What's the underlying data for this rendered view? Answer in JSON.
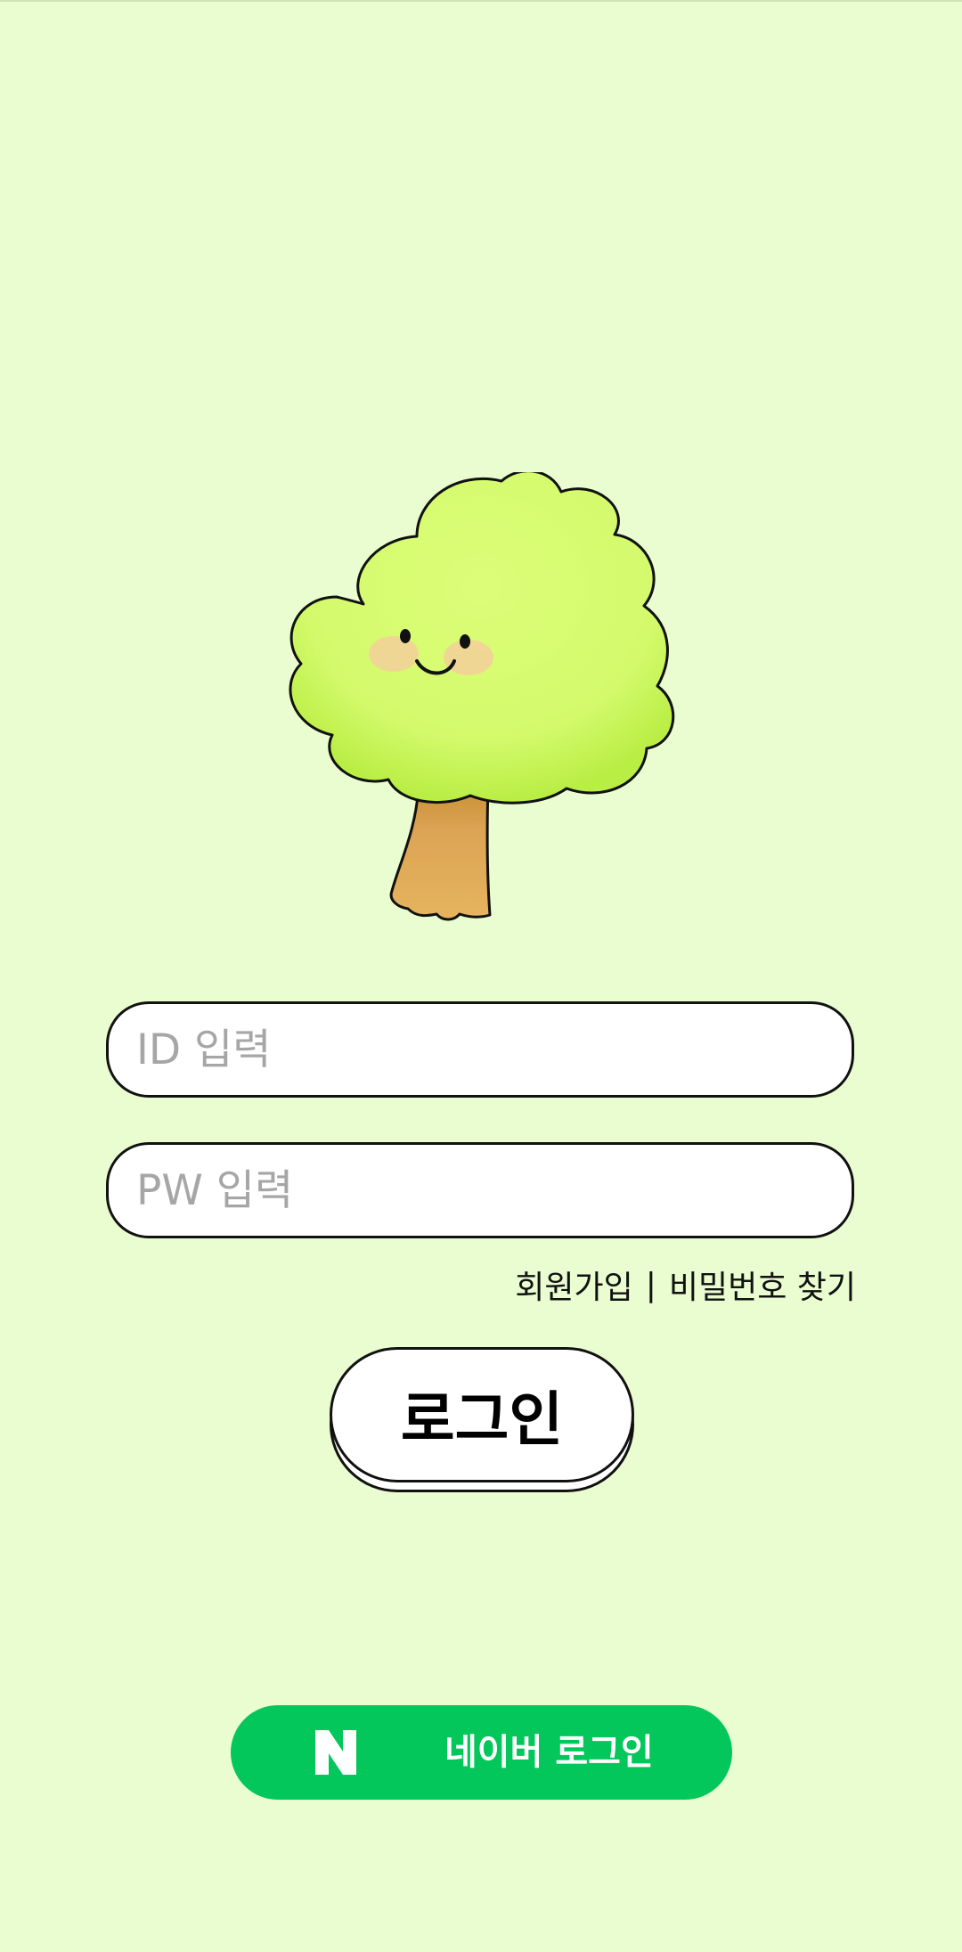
{
  "login_form": {
    "id_placeholder": "ID 입력",
    "pw_placeholder": "PW 입력",
    "signup_link": "회원가입",
    "link_separator": "|",
    "find_password_link": "비밀번호 찾기",
    "login_button": "로그인"
  },
  "social_login": {
    "naver_logo_letter": "N",
    "naver_label": "네이버 로그인"
  },
  "mascot": {
    "icon": "smiling-tree-icon"
  },
  "colors": {
    "background": "#e9fdd0",
    "naver_green": "#03c75a",
    "foliage": "#d6fb72",
    "trunk": "#e2ab58"
  }
}
